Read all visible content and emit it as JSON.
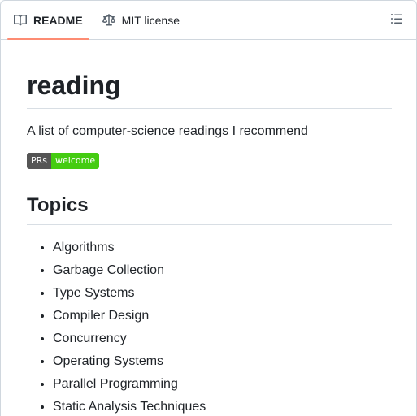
{
  "tabs": [
    {
      "label": "README",
      "icon": "book-icon",
      "active": true
    },
    {
      "label": "MIT license",
      "icon": "law-scale-icon",
      "active": false
    }
  ],
  "outline_button": {
    "icon": "list-unordered-icon"
  },
  "readme": {
    "title": "reading",
    "description": "A list of computer-science readings I recommend",
    "badge": {
      "left": "PRs",
      "right": "welcome",
      "right_color": "#4c1"
    },
    "section_title": "Topics",
    "topics": [
      "Algorithms",
      "Garbage Collection",
      "Type Systems",
      "Compiler Design",
      "Concurrency",
      "Operating Systems",
      "Parallel Programming",
      "Static Analysis Techniques"
    ]
  },
  "colors": {
    "active_tab_underline": "#fd8c73",
    "text": "#1f2328",
    "border": "#d0d7de"
  }
}
